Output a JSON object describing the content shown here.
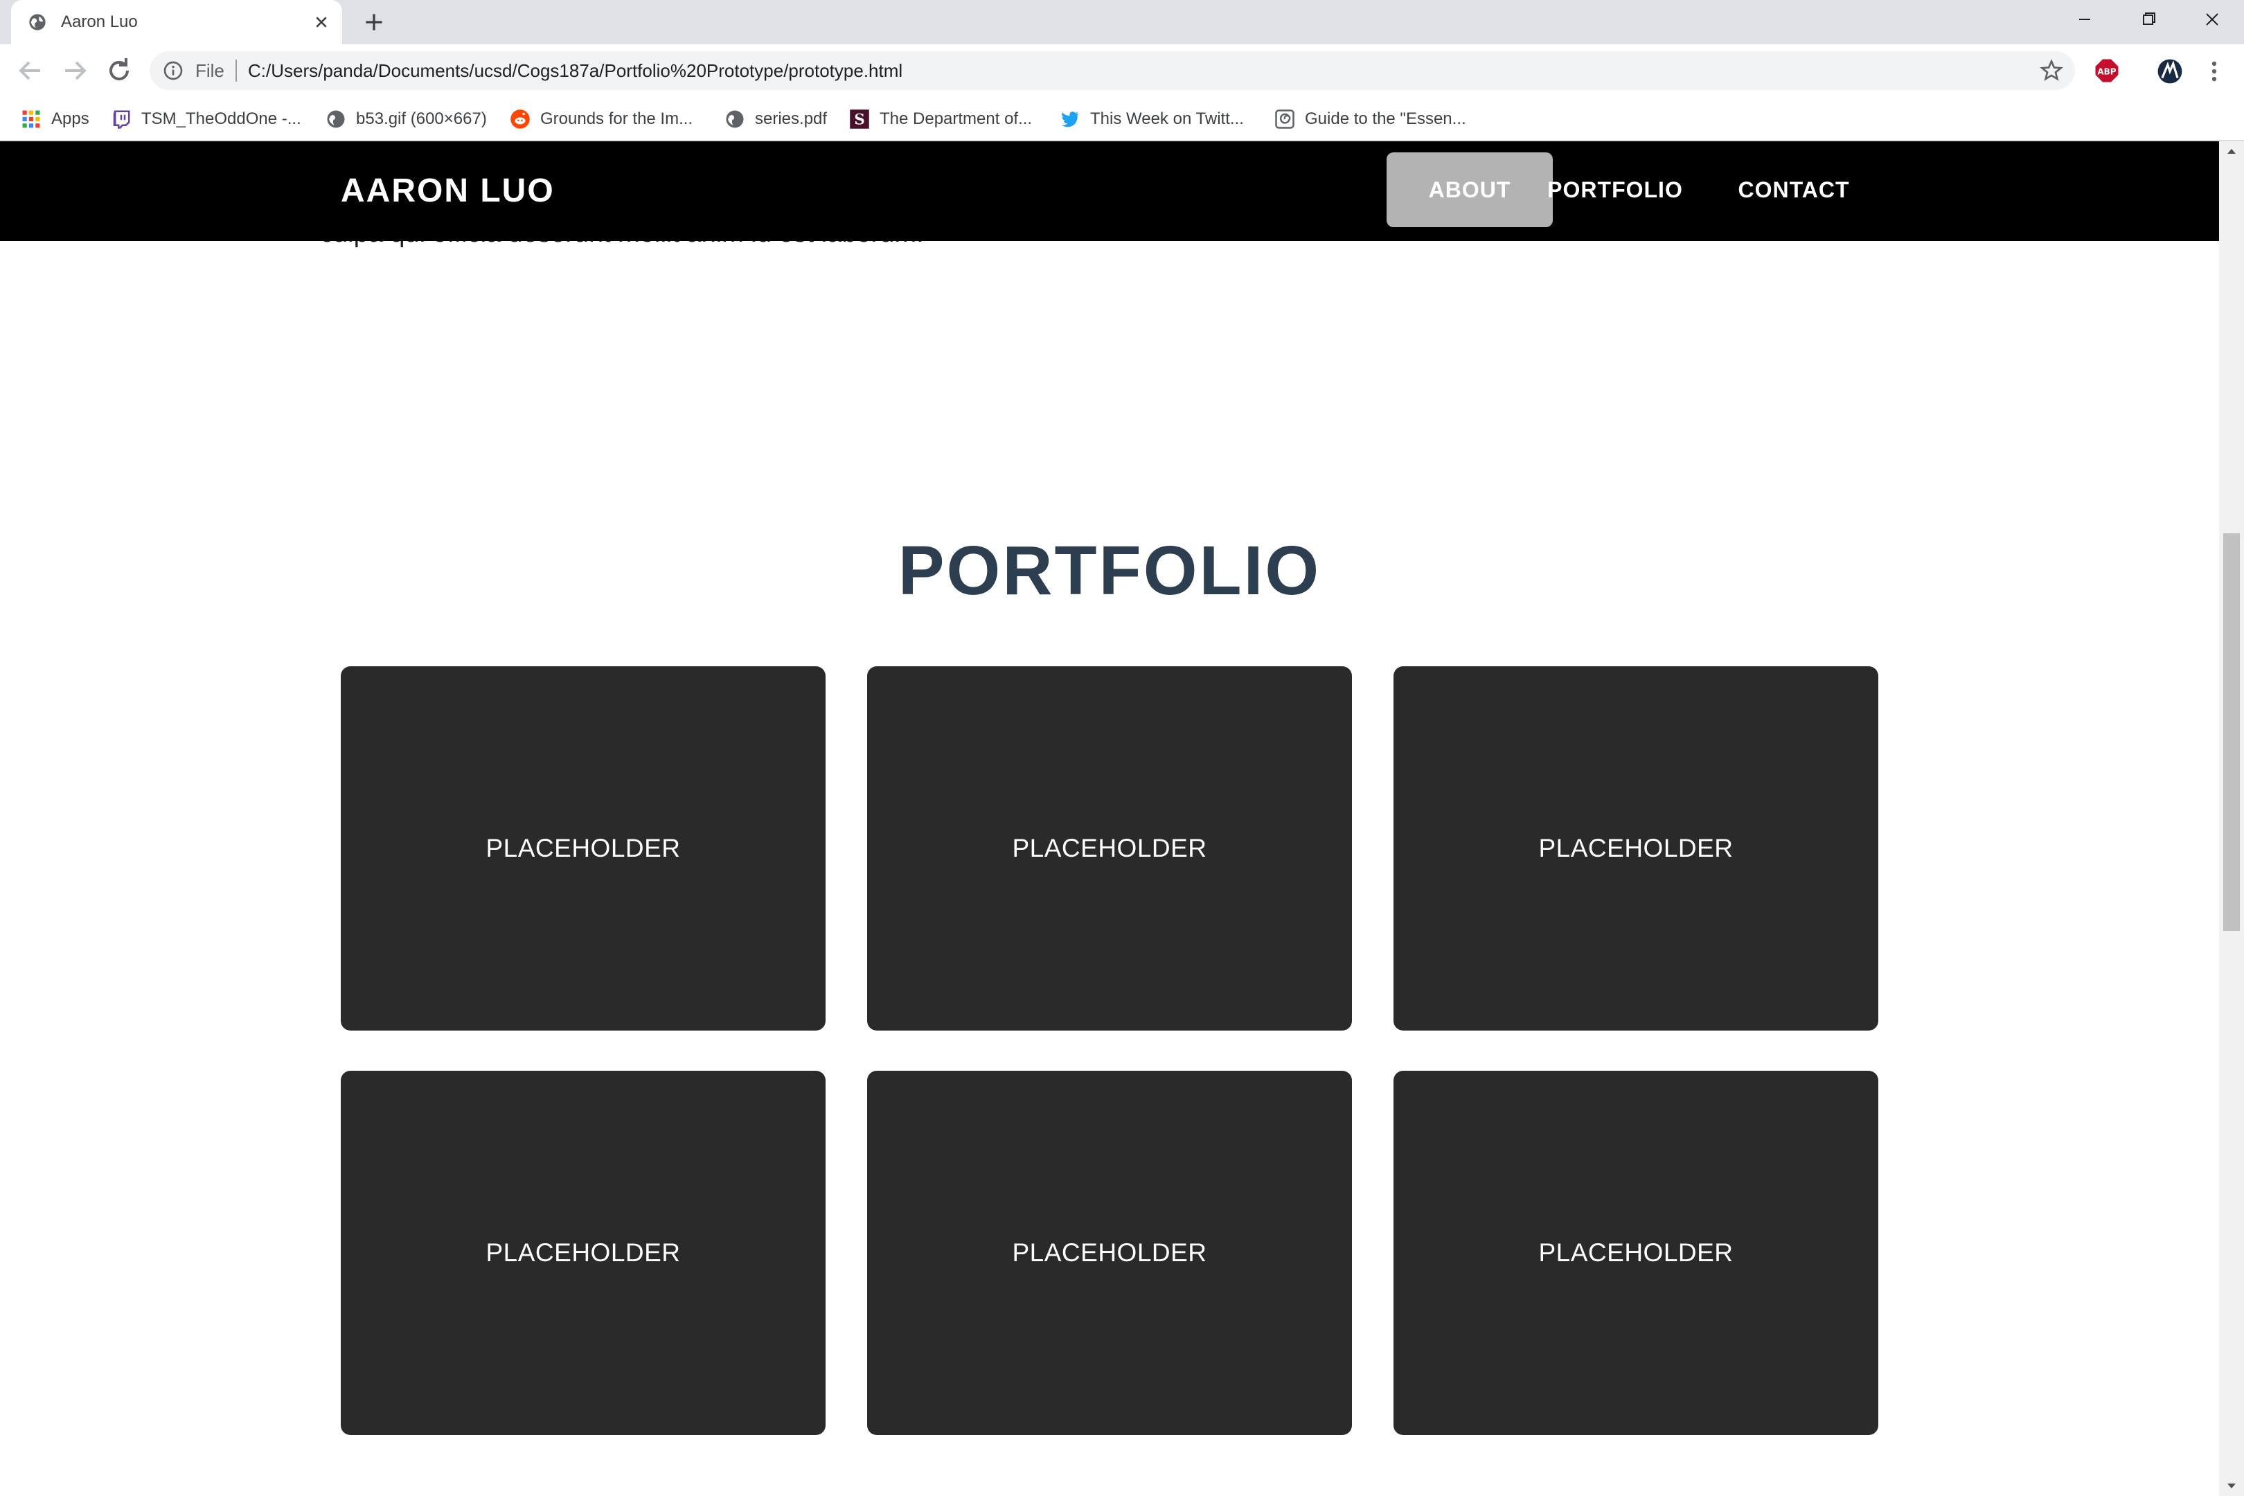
{
  "browser": {
    "tab_title": "Aaron Luo",
    "url_scheme": "File",
    "url": "C:/Users/panda/Documents/ucsd/Cogs187a/Portfolio%20Prototype/prototype.html",
    "extension_label": "ABP",
    "bookmarks": [
      {
        "label": "Apps",
        "icon": "apps-grid-icon",
        "color": "#ea4335"
      },
      {
        "label": "TSM_TheOddOne -...",
        "icon": "twitch-icon",
        "color": "#6441a5"
      },
      {
        "label": "b53.gif (600×667)",
        "icon": "globe-icon",
        "color": "#5f6368"
      },
      {
        "label": "Grounds for the Im...",
        "icon": "reddit-icon",
        "color": "#ff4500"
      },
      {
        "label": "series.pdf",
        "icon": "globe-icon",
        "color": "#5f6368"
      },
      {
        "label": "The Department of...",
        "icon": "s-logo-icon",
        "color": "#4a0f2a"
      },
      {
        "label": "This Week on Twitt...",
        "icon": "twitter-icon",
        "color": "#1da1f2"
      },
      {
        "label": "Guide to the \"Essen...",
        "icon": "swirl-icon",
        "color": "#5f6368"
      }
    ]
  },
  "site": {
    "brand": "AARON LUO",
    "nav": [
      {
        "label": "ABOUT",
        "active": true
      },
      {
        "label": "PORTFOLIO",
        "active": false
      },
      {
        "label": "CONTACT",
        "active": false
      }
    ],
    "partial_text": "culpa qui officia deserunt mollit anim id est laborum.",
    "portfolio": {
      "heading": "PORTFOLIO",
      "items": [
        {
          "label": "PLACEHOLDER"
        },
        {
          "label": "PLACEHOLDER"
        },
        {
          "label": "PLACEHOLDER"
        },
        {
          "label": "PLACEHOLDER"
        },
        {
          "label": "PLACEHOLDER"
        },
        {
          "label": "PLACEHOLDER"
        }
      ]
    },
    "colors": {
      "navbar": "#000000",
      "nav_active": "#b3b3b3",
      "heading": "#2c3e50",
      "card": "#2a2a2a"
    }
  }
}
